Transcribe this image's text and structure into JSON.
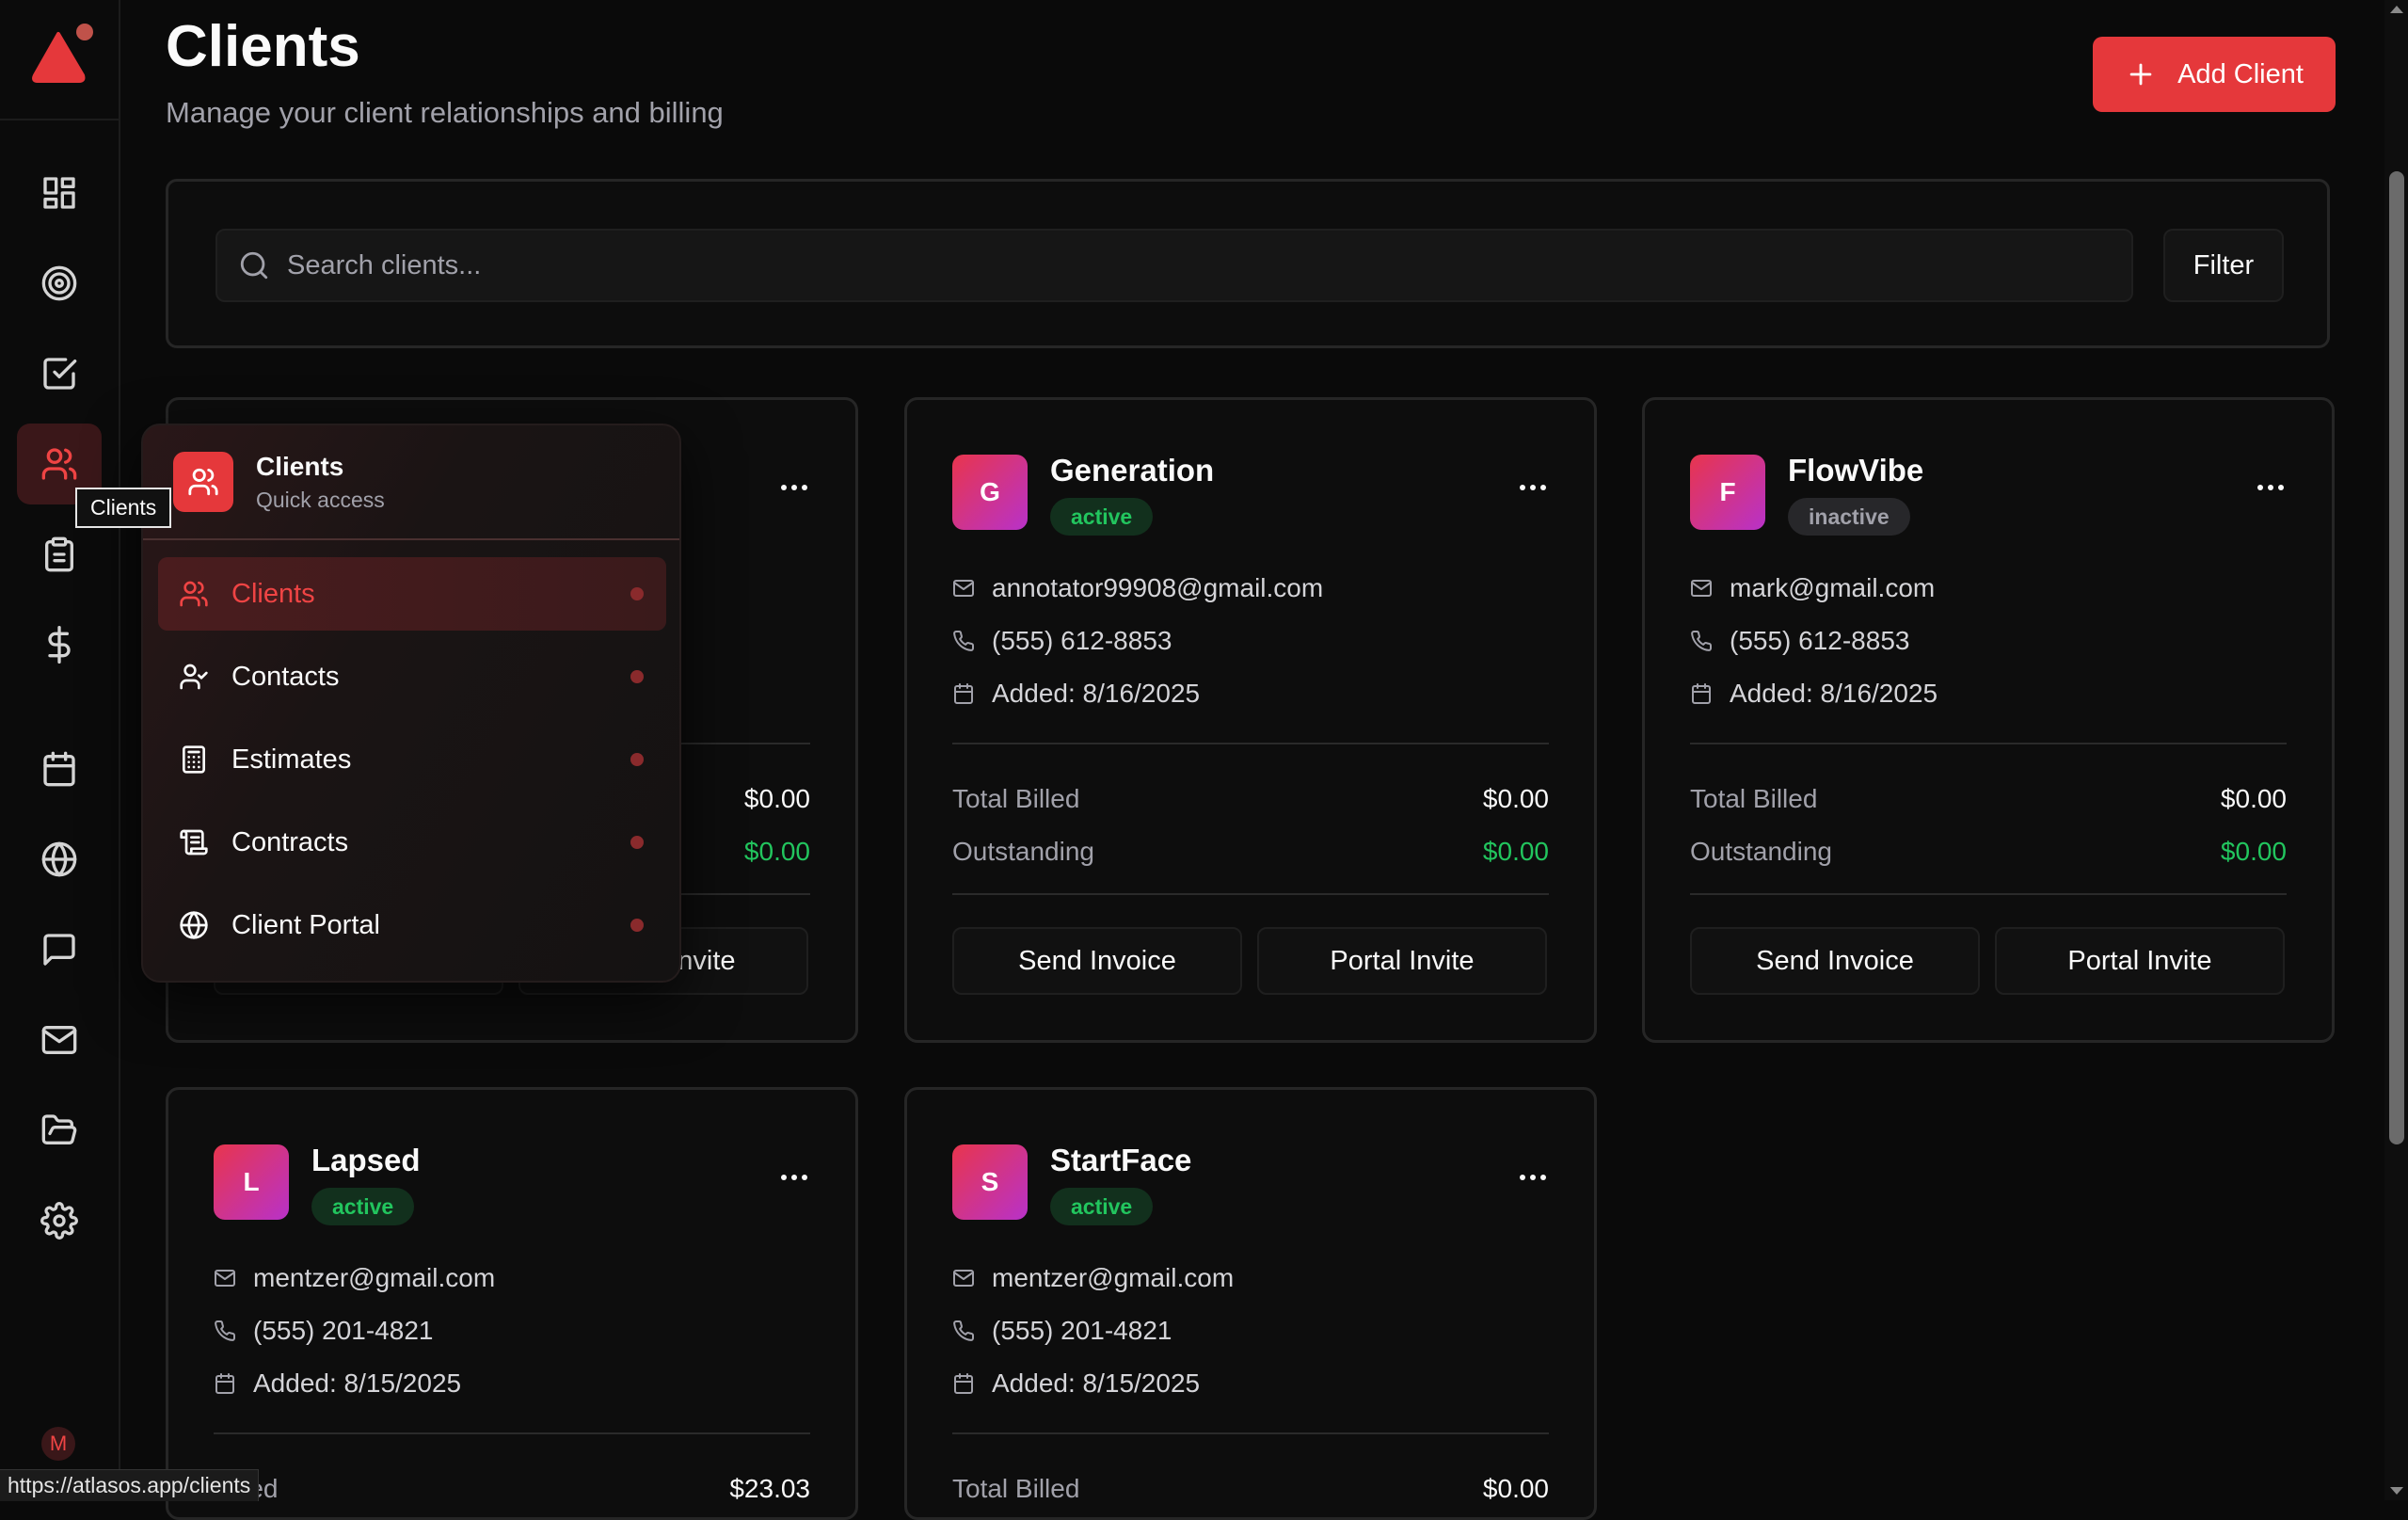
{
  "header": {
    "title": "Clients",
    "subtitle": "Manage your client relationships and billing",
    "add_button": "Add Client"
  },
  "search": {
    "placeholder": "Search clients...",
    "filter_label": "Filter"
  },
  "labels": {
    "total_billed": "Total Billed",
    "outstanding": "Outstanding",
    "send_invoice": "Send Invoice",
    "portal_invite": "Portal Invite"
  },
  "clients": [
    {
      "initial": "",
      "name": "",
      "status": "",
      "email": "",
      "phone": "",
      "added": "",
      "total_billed": "$0.00",
      "outstanding": "$0.00",
      "send_invoice_visible": "",
      "portal_invite_visible": "nvite"
    },
    {
      "initial": "G",
      "name": "Generation",
      "status": "active",
      "email": "annotator99908@gmail.com",
      "phone": "(555) 612-8853",
      "added": "Added: 8/16/2025",
      "total_billed": "$0.00",
      "outstanding": "$0.00"
    },
    {
      "initial": "F",
      "name": "FlowVibe",
      "status": "inactive",
      "email": "mark@gmail.com",
      "phone": "(555) 612-8853",
      "added": "Added: 8/16/2025",
      "total_billed": "$0.00",
      "outstanding": "$0.00"
    },
    {
      "initial": "L",
      "name": "Lapsed",
      "status": "active",
      "email": "mentzer@gmail.com",
      "phone": "(555) 201-4821",
      "added": "Added: 8/15/2025",
      "total_billed_label": "Billed",
      "total_billed": "$23.03"
    },
    {
      "initial": "S",
      "name": "StartFace",
      "status": "active",
      "email": "mentzer@gmail.com",
      "phone": "(555) 201-4821",
      "added": "Added: 8/15/2025",
      "total_billed": "$0.00"
    }
  ],
  "popover": {
    "title": "Clients",
    "subtitle": "Quick access",
    "items": [
      {
        "label": "Clients",
        "icon": "users-icon"
      },
      {
        "label": "Contacts",
        "icon": "user-check-icon"
      },
      {
        "label": "Estimates",
        "icon": "calculator-icon"
      },
      {
        "label": "Contracts",
        "icon": "scroll-icon"
      },
      {
        "label": "Client Portal",
        "icon": "globe-icon"
      }
    ]
  },
  "tooltip": "Clients",
  "sidebar": {
    "items": [
      "dashboard-icon",
      "target-icon",
      "check-square-icon",
      "users-icon",
      "clipboard-icon",
      "dollar-icon",
      "calendar-icon",
      "globe-icon",
      "message-icon",
      "mail-icon",
      "folder-icon",
      "settings-icon"
    ],
    "active_index": 3,
    "user_initial": "M"
  },
  "status_url": "https://atlasos.app/clients",
  "colors": {
    "accent": "#e5383b",
    "active_green": "#22c55e",
    "background": "#0a0a0a"
  }
}
